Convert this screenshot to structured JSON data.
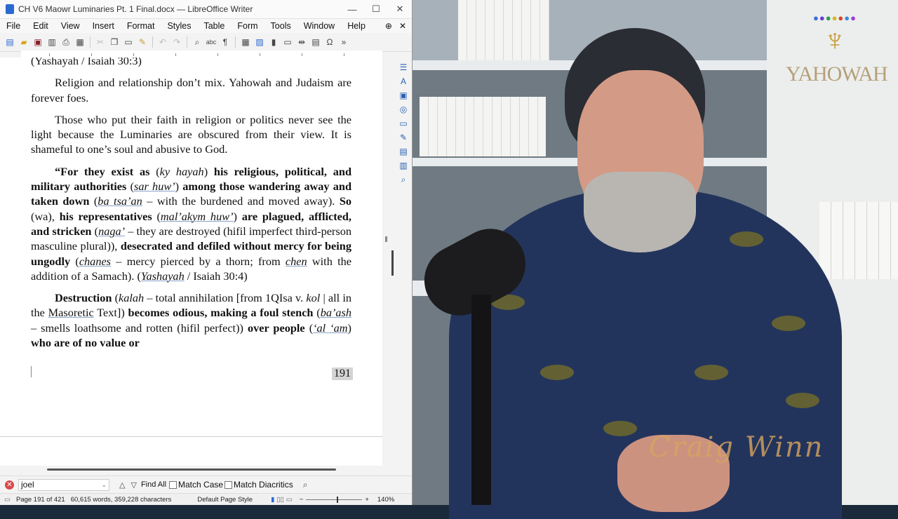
{
  "window": {
    "title": "CH V6 Maowr Luminaries Pt. 1 Final.docx — LibreOffice Writer",
    "min": "—",
    "max": "☐",
    "close": "✕"
  },
  "menu": [
    "File",
    "Edit",
    "View",
    "Insert",
    "Format",
    "Styles",
    "Table",
    "Form",
    "Tools",
    "Window",
    "Help"
  ],
  "document": {
    "top_cut": "(Yashayah / Isaiah 30:3)",
    "p1": "Religion and relationship don’t mix. Yahowah and Judaism are forever foes.",
    "p2": "Those who put their faith in religion or politics never see the light because the Luminaries are obscured from their view. It is shameful to one’s soul and abusive to God.",
    "p3": {
      "a": "“For they exist as",
      "b": "(",
      "c": "ky hayah",
      "d": ")",
      "e": "his religious, political, and military authorities",
      "f": "(",
      "g": "sar huw’",
      "h": ")",
      "i": "among those wandering away and taken down",
      "j": "(",
      "k": "ba tsa’an",
      "l": "– with the burdened and moved away).",
      "m": "So",
      "n": "(wa),",
      "o": "his representatives",
      "p": "(",
      "q": "mal’akym huw’",
      "r": ")",
      "s": "are plagued, afflicted, and stricken",
      "t": "(",
      "u": "naga’",
      "v": "– they are destroyed (hifil imperfect third-person masculine plural)),",
      "w": "desecrated and defiled without mercy for being ungodly",
      "x": "(",
      "y": "chanes",
      "z": "– mercy pierced by a thorn; from",
      "aa": "chen",
      "ab": "with the addition of a Samach).",
      "ac": "(",
      "ad": "Yashayah",
      "ae": "/ Isaiah 30:4)"
    },
    "p4": {
      "a": "Destruction",
      "b": "(",
      "c": "kalah",
      "d": "– total annihilation [from 1QIsa v.",
      "e": "kol",
      "f": "| all in the",
      "g": "Masoretic",
      "h": "Text])",
      "i": "becomes odious, making a foul stench",
      "j": "(",
      "k": "ba’ash",
      "l": "– smells loathsome and rotten (hifil perfect))",
      "m": "over people",
      "n": "(",
      "o": "‘al ‘am",
      "p": ")",
      "q": "who are of no value or"
    },
    "page_number": "191"
  },
  "find": {
    "value": "joel",
    "find_all": "Find All",
    "match_case": "Match Case",
    "match_diacritics": "Match Diacritics"
  },
  "status": {
    "page": "Page 191 of 421",
    "words": "60,615 words, 359,228 characters",
    "style": "Default Page Style",
    "zoom": "140%"
  },
  "video": {
    "logo_text": "YAHOWAH",
    "signature": "Craig Winn"
  },
  "colors": {
    "accent": "#2a6ad0",
    "video_bg": "#6f7a83",
    "logo": "#c79b3a"
  },
  "icons": [
    "new-icon",
    "open-icon",
    "save-icon",
    "export-pdf-icon",
    "print-icon",
    "print-preview-icon",
    "cut-icon",
    "copy-icon",
    "paste-icon",
    "clone-icon",
    "undo-icon",
    "redo-icon",
    "find-replace-icon",
    "spelling-icon",
    "formatting-marks-icon",
    "table-icon",
    "image-icon",
    "chart-icon",
    "textbox-icon",
    "page-break-icon",
    "field-icon",
    "special-char-icon",
    "more-icon"
  ]
}
